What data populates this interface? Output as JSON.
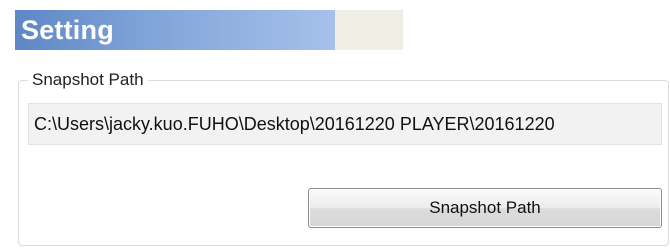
{
  "header": {
    "title": "Setting"
  },
  "snapshot": {
    "group_label": "Snapshot Path",
    "path_value": "C:\\Users\\jacky.kuo.FUHO\\Desktop\\20161220 PLAYER\\20161220",
    "button_label": "Snapshot Path"
  },
  "colors": {
    "title_gradient_start": "#5f87c5",
    "title_gradient_end": "#a6c1ea",
    "title_bar_background": "#efeee4",
    "field_background": "#f2f2f2"
  }
}
